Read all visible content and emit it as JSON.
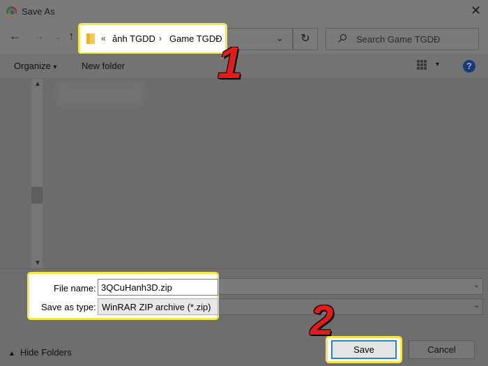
{
  "window": {
    "title": "Save As",
    "close_glyph": "✕"
  },
  "nav": {
    "back_glyph": "←",
    "forward_glyph": "→",
    "history_glyph": "⌄",
    "up_glyph": "↑",
    "refresh_glyph": "↻",
    "address_dropdown_glyph": "⌄"
  },
  "breadcrumb": {
    "overflow": "«",
    "separator": "›",
    "items": [
      "ảnh TGDD",
      "Game TGDĐ"
    ]
  },
  "search": {
    "placeholder": "Search Game TGDĐ"
  },
  "toolbar": {
    "organize_label": "Organize",
    "organize_arrow": "▾",
    "new_folder_label": "New folder",
    "view_dropdown_glyph": "▾",
    "help_glyph": "?"
  },
  "scrollbar": {
    "up_glyph": "▲",
    "down_glyph": "▼"
  },
  "form": {
    "file_name_label": "File name:",
    "file_name_value": "3QCuHanh3D.zip",
    "save_type_label": "Save as type:",
    "save_type_value": "WinRAR ZIP archive (*.zip)",
    "dropdown_glyph": "⌄"
  },
  "footer": {
    "hide_folders_chevron": "▲",
    "hide_folders_label": "Hide Folders",
    "save_label": "Save",
    "cancel_label": "Cancel"
  },
  "annotations": {
    "step1": "1",
    "step2": "2",
    "highlight_color": "#f5e64a",
    "step_color": "#e41b1b"
  },
  "colors": {
    "dim_overlay": "#6e6e6e",
    "save_border": "#1a76c9",
    "help_icon": "#15397a"
  }
}
